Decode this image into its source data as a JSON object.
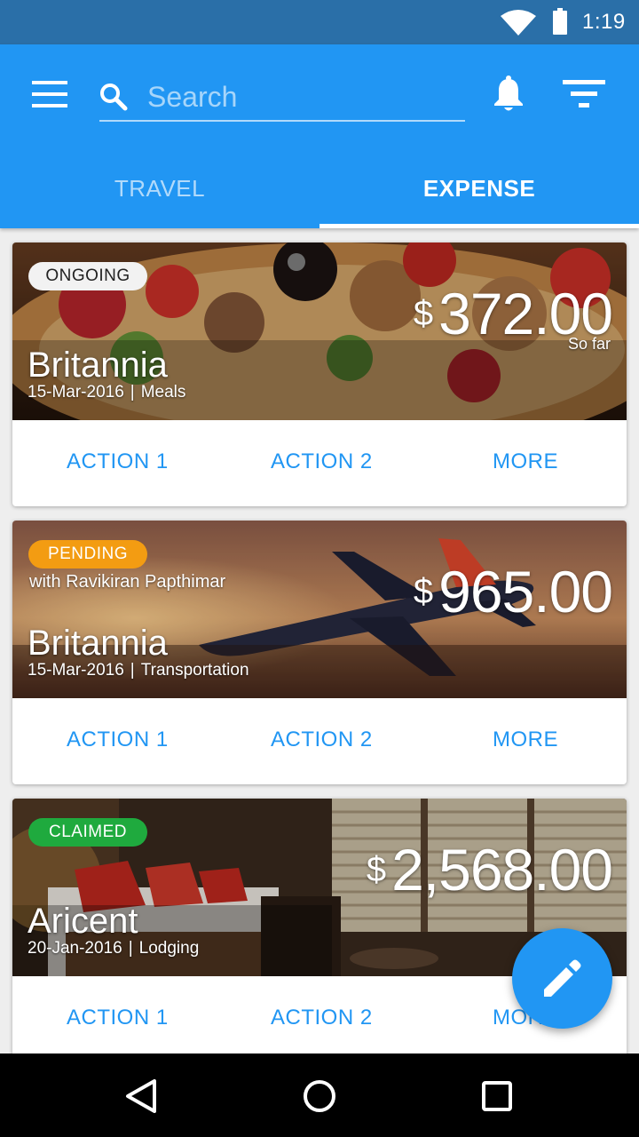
{
  "status_bar": {
    "time": "1:19"
  },
  "app_bar": {
    "search": {
      "placeholder": "Search",
      "value": ""
    },
    "tabs": [
      {
        "label": "TRAVEL",
        "selected": false
      },
      {
        "label": "EXPENSE",
        "selected": true
      }
    ]
  },
  "cards": [
    {
      "status": "ONGOING",
      "status_color": "#f2f2f2",
      "subtitle": "",
      "currency": "$",
      "amount": "372.00",
      "amount_note": "So far",
      "title": "Britannia",
      "date": "15-Mar-2016",
      "category": "Meals",
      "actions": [
        "ACTION 1",
        "ACTION 2",
        "MORE"
      ]
    },
    {
      "status": "PENDING",
      "status_color": "#f39c12",
      "subtitle": "with Ravikiran Papthimar",
      "currency": "$",
      "amount": "965.00",
      "amount_note": "",
      "title": "Britannia",
      "date": "15-Mar-2016",
      "category": "Transportation",
      "actions": [
        "ACTION 1",
        "ACTION 2",
        "MORE"
      ]
    },
    {
      "status": "CLAIMED",
      "status_color": "#1faa3e",
      "subtitle": "",
      "currency": "$",
      "amount": "2,568.00",
      "amount_note": "",
      "title": "Aricent",
      "date": "20-Jan-2016",
      "category": "Lodging",
      "actions": [
        "ACTION 1",
        "ACTION 2",
        "MORE"
      ]
    }
  ],
  "colors": {
    "primary": "#2196f3",
    "status_bar": "#2a6fa8"
  },
  "icons": [
    "wifi-icon",
    "battery-icon",
    "menu-icon",
    "search-icon",
    "bell-icon",
    "filter-icon",
    "edit-pencil-icon",
    "nav-back-icon",
    "nav-home-icon",
    "nav-recents-icon"
  ]
}
